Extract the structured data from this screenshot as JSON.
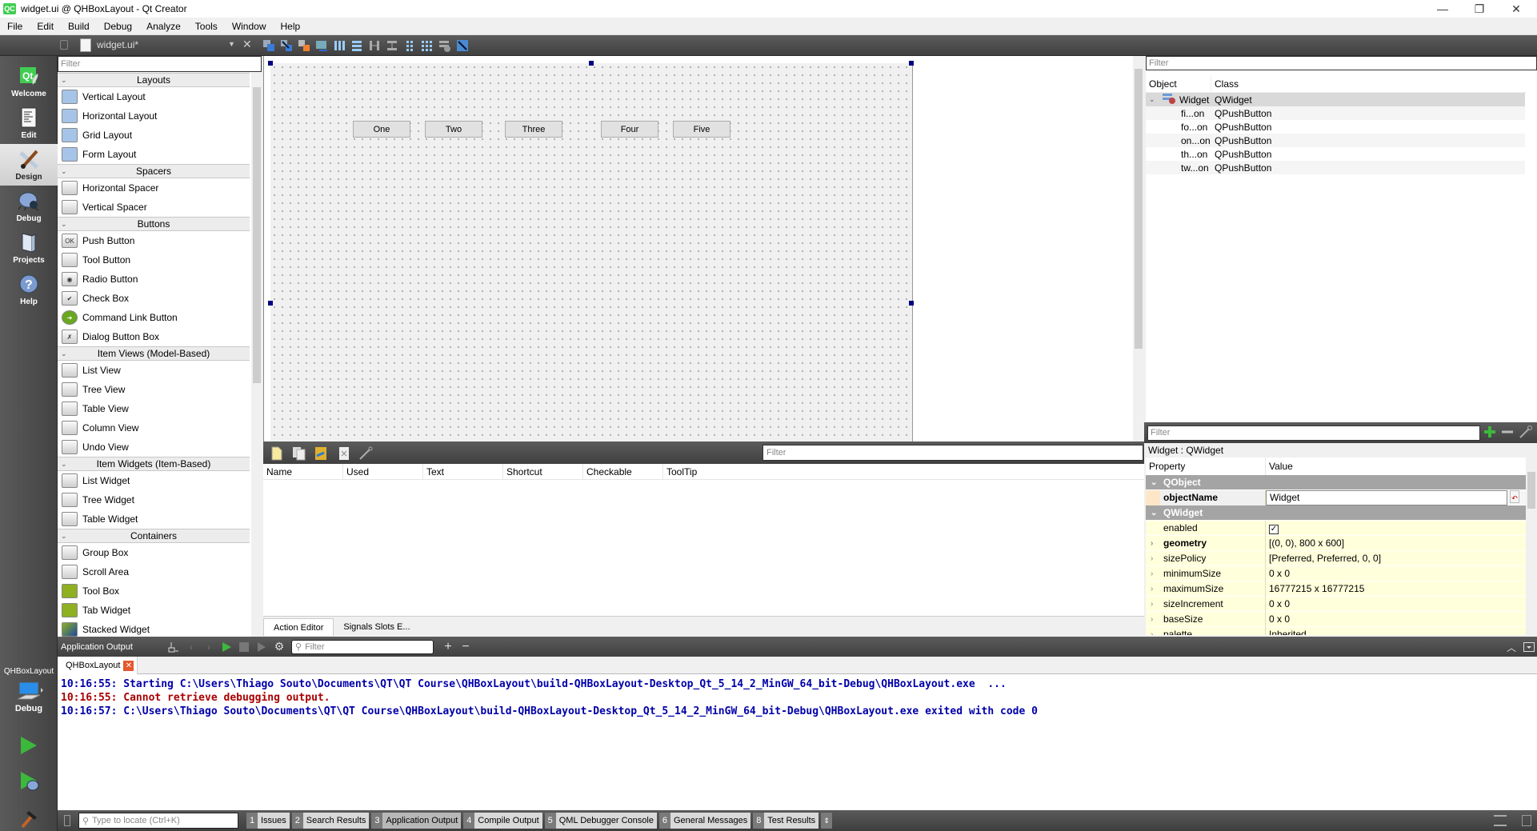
{
  "window": {
    "title": "widget.ui @ QHBoxLayout - Qt Creator",
    "app_icon": "QC",
    "controls": {
      "minimize": "—",
      "restore": "❐",
      "close": "✕"
    }
  },
  "menu": [
    "File",
    "Edit",
    "Build",
    "Debug",
    "Analyze",
    "Tools",
    "Window",
    "Help"
  ],
  "editor_toolbar": {
    "document": "widget.ui*",
    "tool_icons": [
      "edit-widgets-icon",
      "edit-signals-slots-icon",
      "edit-buddies-icon",
      "edit-tab-order-icon",
      "layout-horizontal-icon",
      "layout-vertical-icon",
      "layout-h-splitter-icon",
      "layout-v-splitter-icon",
      "layout-form-icon",
      "layout-grid-icon",
      "break-layout-icon",
      "adjust-size-icon"
    ]
  },
  "modes": [
    {
      "label": "Welcome",
      "icon": "qt-logo-icon"
    },
    {
      "label": "Edit",
      "icon": "edit-document-icon"
    },
    {
      "label": "Design",
      "icon": "design-brush-icon",
      "active": true
    },
    {
      "label": "Debug",
      "icon": "bug-icon"
    },
    {
      "label": "Projects",
      "icon": "projects-folder-icon"
    },
    {
      "label": "Help",
      "icon": "help-question-icon"
    }
  ],
  "kit": {
    "project": "QHBoxLayout",
    "build": "Debug"
  },
  "widget_box": {
    "filter_placeholder": "Filter",
    "categories": [
      {
        "name": "Layouts",
        "items": [
          "Vertical Layout",
          "Horizontal Layout",
          "Grid Layout",
          "Form Layout"
        ]
      },
      {
        "name": "Spacers",
        "items": [
          "Horizontal Spacer",
          "Vertical Spacer"
        ]
      },
      {
        "name": "Buttons",
        "items": [
          "Push Button",
          "Tool Button",
          "Radio Button",
          "Check Box",
          "Command Link Button",
          "Dialog Button Box"
        ]
      },
      {
        "name": "Item Views (Model-Based)",
        "items": [
          "List View",
          "Tree View",
          "Table View",
          "Column View",
          "Undo View"
        ]
      },
      {
        "name": "Item Widgets (Item-Based)",
        "items": [
          "List Widget",
          "Tree Widget",
          "Table Widget"
        ]
      },
      {
        "name": "Containers",
        "items": [
          "Group Box",
          "Scroll Area",
          "Tool Box",
          "Tab Widget",
          "Stacked Widget"
        ]
      }
    ]
  },
  "form": {
    "buttons": [
      "One",
      "Two",
      "Three",
      "Four",
      "Five"
    ]
  },
  "action_editor": {
    "filter_placeholder": "Filter",
    "columns": [
      "Name",
      "Used",
      "Text",
      "Shortcut",
      "Checkable",
      "ToolTip"
    ],
    "tabs": [
      "Action Editor",
      "Signals Slots E..."
    ]
  },
  "object_inspector": {
    "filter_placeholder": "Filter",
    "columns": [
      "Object",
      "Class"
    ],
    "root": {
      "object": "Widget",
      "class": "QWidget"
    },
    "children": [
      {
        "object": "fi...on",
        "class": "QPushButton"
      },
      {
        "object": "fo...on",
        "class": "QPushButton"
      },
      {
        "object": "on...on",
        "class": "QPushButton"
      },
      {
        "object": "th...on",
        "class": "QPushButton"
      },
      {
        "object": "tw...on",
        "class": "QPushButton"
      }
    ]
  },
  "property_editor": {
    "filter_placeholder": "Filter",
    "context": "Widget : QWidget",
    "columns": [
      "Property",
      "Value"
    ],
    "groups": {
      "qobject": "QObject",
      "qwidget": "QWidget"
    },
    "object_name": {
      "name": "objectName",
      "value": "Widget"
    },
    "enabled": {
      "name": "enabled",
      "checked": true
    },
    "rows": [
      {
        "name": "geometry",
        "value": "[(0, 0), 800 x 600]"
      },
      {
        "name": "sizePolicy",
        "value": "[Preferred, Preferred, 0, 0]"
      },
      {
        "name": "minimumSize",
        "value": "0 x 0"
      },
      {
        "name": "maximumSize",
        "value": "16777215 x 16777215"
      },
      {
        "name": "sizeIncrement",
        "value": "0 x 0"
      },
      {
        "name": "baseSize",
        "value": "0 x 0"
      },
      {
        "name": "palette",
        "value": "Inherited"
      }
    ]
  },
  "output": {
    "title": "Application Output",
    "filter_placeholder": "Filter",
    "tab": "QHBoxLayout",
    "lines": [
      {
        "text": "10:16:55: Starting C:\\Users\\Thiago Souto\\Documents\\QT\\QT Course\\QHBoxLayout\\build-QHBoxLayout-Desktop_Qt_5_14_2_MinGW_64_bit-Debug\\QHBoxLayout.exe  ...",
        "color": "#0000aa"
      },
      {
        "text": "10:16:55: Cannot retrieve debugging output.",
        "color": "#aa0000"
      },
      {
        "text": "10:16:57: C:\\Users\\Thiago Souto\\Documents\\QT\\QT Course\\QHBoxLayout\\build-QHBoxLayout-Desktop_Qt_5_14_2_MinGW_64_bit-Debug\\QHBoxLayout.exe exited with code 0",
        "color": "#0000aa"
      }
    ]
  },
  "status_bar": {
    "locator_placeholder": "Type to locate (Ctrl+K)",
    "panes": [
      {
        "num": "1",
        "label": "Issues"
      },
      {
        "num": "2",
        "label": "Search Results"
      },
      {
        "num": "3",
        "label": "Application Output",
        "active": true
      },
      {
        "num": "4",
        "label": "Compile Output"
      },
      {
        "num": "5",
        "label": "QML Debugger Console"
      },
      {
        "num": "6",
        "label": "General Messages"
      },
      {
        "num": "8",
        "label": "Test Results"
      }
    ]
  },
  "colors": {
    "selection_handle": "#000080",
    "property_highlight": "#ffffdc",
    "property_group": "#a4a4a4",
    "output_blue": "#0000aa",
    "output_red": "#aa0000",
    "run_green": "#3cb83c"
  }
}
